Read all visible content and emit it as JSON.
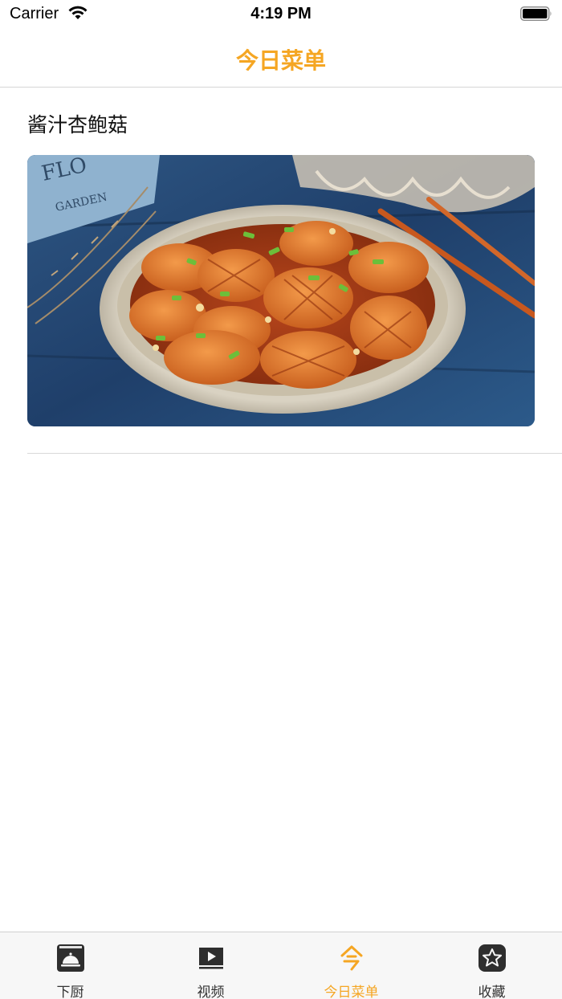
{
  "status_bar": {
    "carrier": "Carrier",
    "time": "4:19 PM",
    "wifi_icon": "wifi-icon",
    "battery_icon": "battery-icon"
  },
  "nav": {
    "title": "今日菜单"
  },
  "recipe": {
    "title": "酱汁杏鲍菇",
    "image": "braised-king-oyster-mushroom-dish-photo"
  },
  "tab_bar": {
    "tabs": [
      {
        "label": "下厨",
        "icon": "cloche-icon",
        "active": false
      },
      {
        "label": "视频",
        "icon": "video-play-icon",
        "active": false
      },
      {
        "label": "今日菜单",
        "icon": "today-menu-icon",
        "active": true
      },
      {
        "label": "收藏",
        "icon": "star-icon",
        "active": false
      }
    ]
  },
  "colors": {
    "accent": "#f5a623",
    "text": "#111111",
    "divider": "#d8d8d8",
    "tab_bar_bg": "#f7f7f7"
  }
}
